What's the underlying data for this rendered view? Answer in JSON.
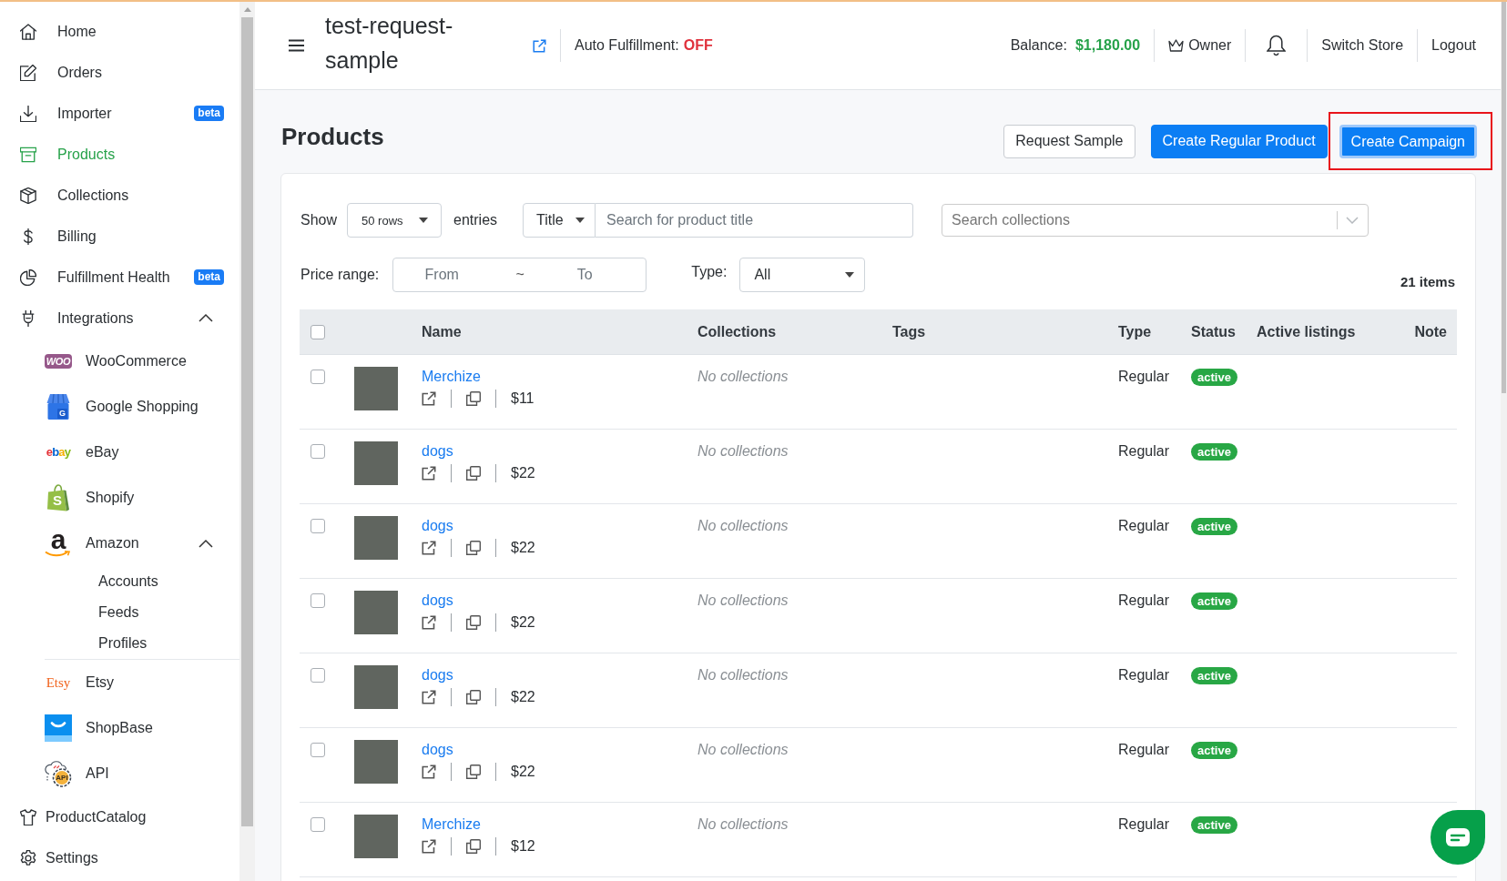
{
  "sidebar": {
    "items": [
      {
        "label": "Home",
        "selected": false
      },
      {
        "label": "Orders",
        "selected": false
      },
      {
        "label": "Importer",
        "selected": false,
        "badge": "beta"
      },
      {
        "label": "Products",
        "selected": true
      },
      {
        "label": "Collections",
        "selected": false
      },
      {
        "label": "Billing",
        "selected": false
      },
      {
        "label": "Fulfillment Health",
        "selected": false,
        "badge": "beta"
      },
      {
        "label": "Integrations",
        "selected": false,
        "expanded": true,
        "children": [
          {
            "label": "WooCommerce",
            "selected": false,
            "logo_text": "WOO"
          },
          {
            "label": "Google Shopping",
            "selected": false,
            "logo_text": "G"
          },
          {
            "label": "eBay",
            "selected": false,
            "logo_text": "ebay"
          },
          {
            "label": "Shopify",
            "selected": false,
            "logo_text": "S"
          },
          {
            "label": "Amazon",
            "selected": false,
            "logo_text": "a",
            "expanded": true,
            "children": [
              {
                "label": "Accounts",
                "selected": false
              },
              {
                "label": "Feeds",
                "selected": false
              },
              {
                "label": "Profiles",
                "selected": false
              }
            ]
          },
          {
            "label": "Etsy",
            "selected": false,
            "logo_text": "Etsy"
          },
          {
            "label": "ShopBase",
            "selected": false
          },
          {
            "label": "API",
            "selected": false,
            "logo_text": "API"
          }
        ]
      },
      {
        "label": "ProductCatalog",
        "selected": false
      },
      {
        "label": "Settings",
        "selected": false
      }
    ]
  },
  "header": {
    "store_name": "test-request-sample",
    "auto_fulfillment": {
      "label": "Auto Fulfillment:",
      "value": "OFF",
      "on": false
    },
    "balance": {
      "label": "Balance:",
      "value": "$1,180.00"
    },
    "role": "Owner",
    "links": [
      "Switch Store",
      "Logout"
    ]
  },
  "page": {
    "title": "Products",
    "actions": [
      {
        "label": "Request Sample",
        "kind": "secondary",
        "highlighted": false
      },
      {
        "label": "Create Regular Product",
        "kind": "primary",
        "highlighted": false
      },
      {
        "label": "Create Campaign",
        "kind": "primary",
        "highlighted": true
      }
    ]
  },
  "filters": {
    "show": {
      "label": "Show",
      "value": "50 rows",
      "suffix": "entries"
    },
    "search": {
      "field": "Title",
      "placeholder": "Search for product title"
    },
    "collections": {
      "placeholder": "Search collections"
    },
    "price_range": {
      "label": "Price range:",
      "from_placeholder": "From",
      "separator": "~",
      "to_placeholder": "To"
    },
    "type": {
      "label": "Type:",
      "value": "All"
    },
    "count": "21 items"
  },
  "table": {
    "select_all": {
      "checked": false
    },
    "columns": [
      "Name",
      "Collections",
      "Tags",
      "Type",
      "Status",
      "Active listings",
      "Note"
    ],
    "rows": [
      {
        "checked": false,
        "name": "Merchize",
        "price": "$11",
        "collections": "No collections",
        "type": "Regular",
        "status": "active"
      },
      {
        "checked": false,
        "name": "dogs",
        "price": "$22",
        "collections": "No collections",
        "type": "Regular",
        "status": "active"
      },
      {
        "checked": false,
        "name": "dogs",
        "price": "$22",
        "collections": "No collections",
        "type": "Regular",
        "status": "active"
      },
      {
        "checked": false,
        "name": "dogs",
        "price": "$22",
        "collections": "No collections",
        "type": "Regular",
        "status": "active"
      },
      {
        "checked": false,
        "name": "dogs",
        "price": "$22",
        "collections": "No collections",
        "type": "Regular",
        "status": "active"
      },
      {
        "checked": false,
        "name": "dogs",
        "price": "$22",
        "collections": "No collections",
        "type": "Regular",
        "status": "active"
      },
      {
        "checked": false,
        "name": "Merchize",
        "price": "$12",
        "collections": "No collections",
        "type": "Regular",
        "status": "active"
      }
    ]
  }
}
